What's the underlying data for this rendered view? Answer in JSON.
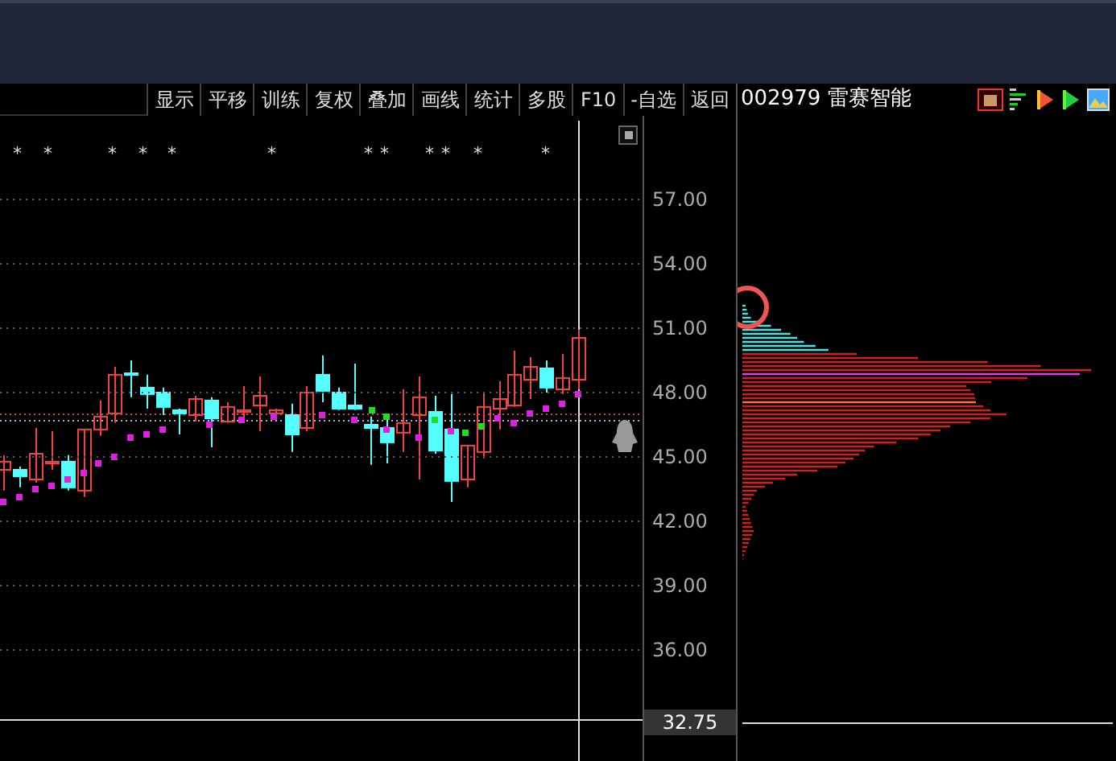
{
  "toolbar": {
    "buttons": [
      "显示",
      "平移",
      "训练",
      "复权",
      "叠加",
      "画线",
      "统计",
      "多股",
      "F10",
      "-自选",
      "返回"
    ]
  },
  "stock": {
    "title": "002979 雷赛智能"
  },
  "chart": {
    "markers": [
      "*",
      "*",
      "*",
      "*",
      "*",
      "*",
      "*",
      "*",
      "*",
      "*",
      "*",
      "*"
    ],
    "current_price": "32.75",
    "chart_data": {
      "type": "candlestick",
      "ohlc": [
        [
          44.4,
          45.08,
          43.43,
          44.78
        ],
        [
          44.4,
          44.55,
          43.58,
          44.1
        ],
        [
          43.95,
          46.35,
          43.8,
          45.15
        ],
        [
          44.7,
          46.2,
          44.4,
          44.78
        ],
        [
          44.78,
          45.08,
          43.43,
          43.58
        ],
        [
          43.43,
          46.28,
          43.13,
          46.28
        ],
        [
          46.28,
          47.63,
          45.98,
          46.88
        ],
        [
          47.03,
          49.2,
          46.58,
          48.83
        ],
        [
          48.9,
          49.5,
          47.78,
          48.83
        ],
        [
          48.23,
          48.83,
          47.25,
          47.93
        ],
        [
          48.0,
          48.23,
          46.95,
          47.33
        ],
        [
          47.18,
          47.25,
          46.05,
          47.03
        ],
        [
          46.95,
          47.85,
          46.65,
          47.7
        ],
        [
          47.63,
          47.78,
          45.45,
          46.8
        ],
        [
          46.65,
          47.55,
          46.58,
          47.33
        ],
        [
          47.1,
          48.3,
          46.65,
          47.18
        ],
        [
          47.4,
          48.75,
          46.2,
          47.85
        ],
        [
          47.03,
          47.25,
          46.8,
          47.18
        ],
        [
          46.95,
          47.48,
          45.23,
          46.05
        ],
        [
          46.35,
          48.3,
          46.2,
          48.0
        ],
        [
          48.83,
          49.73,
          47.55,
          48.08
        ],
        [
          48.0,
          48.23,
          47.18,
          47.25
        ],
        [
          47.4,
          49.35,
          47.18,
          47.25
        ],
        [
          46.5,
          46.88,
          44.63,
          46.35
        ],
        [
          46.35,
          46.8,
          44.7,
          45.68
        ],
        [
          46.13,
          48.15,
          45.23,
          46.58
        ],
        [
          46.95,
          48.75,
          43.95,
          47.78
        ],
        [
          47.1,
          47.85,
          45.15,
          45.3
        ],
        [
          46.28,
          47.93,
          42.9,
          43.88
        ],
        [
          43.95,
          45.53,
          43.58,
          45.53
        ],
        [
          45.23,
          48.0,
          44.93,
          47.33
        ],
        [
          47.25,
          48.53,
          46.28,
          47.7
        ],
        [
          47.4,
          49.95,
          47.33,
          48.83
        ],
        [
          48.6,
          49.65,
          47.7,
          49.2
        ],
        [
          49.13,
          49.5,
          48.0,
          48.23
        ],
        [
          48.15,
          49.8,
          47.93,
          48.68
        ],
        [
          48.6,
          50.93,
          48.15,
          50.55
        ]
      ],
      "ylim": [
        30.825,
        60.9
      ],
      "grid": true,
      "ref_lines": [
        {
          "axis": "y",
          "value": 32.75,
          "color": "#dddddd"
        },
        {
          "axis": "y",
          "value": 47.02,
          "color": "#cc4444"
        },
        {
          "axis": "y",
          "value": 46.73,
          "color": "#aaaacc"
        }
      ],
      "yticks": [
        {
          "value": 57,
          "label": "57.00"
        },
        {
          "value": 54,
          "label": "54.00"
        },
        {
          "value": 51,
          "label": "51.00"
        },
        {
          "value": 48,
          "label": "48.00"
        },
        {
          "value": 45,
          "label": "45.00"
        },
        {
          "value": 42,
          "label": "42.00"
        },
        {
          "value": 39,
          "label": "39.00"
        },
        {
          "value": 36,
          "label": "36.00"
        }
      ]
    }
  }
}
